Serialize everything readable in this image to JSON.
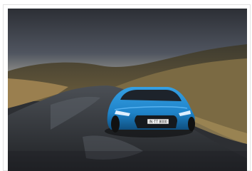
{
  "image": {
    "subject": "car-driving-on-road",
    "colors": {
      "sky_top": "#2c2f35",
      "sky_bottom": "#5a5f68",
      "horizon_glow": "#8a8a86",
      "hill": "#3d3a2e",
      "grass_light": "#8b7a4c",
      "grass_dark": "#4b4634",
      "road": "#2b2d31",
      "road_wet": "#5b6068",
      "car_body": "#1f83c9",
      "car_dark": "#0f4f7f",
      "headlight": "#dfefff"
    },
    "license_plate": "IN·TT 8000"
  }
}
